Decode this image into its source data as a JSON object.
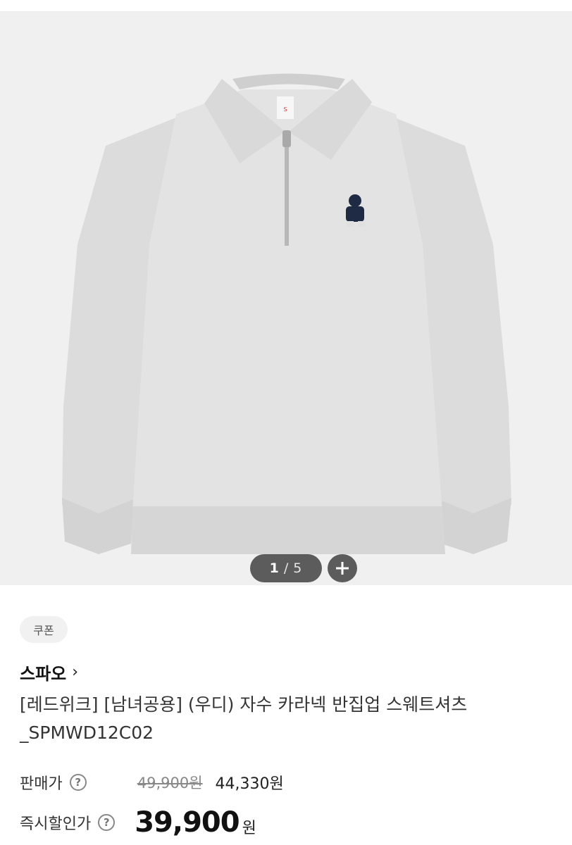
{
  "gallery": {
    "current": "1",
    "separator": "/",
    "total": "5",
    "image": {
      "main": "#e6e6e6",
      "accent": "#1f2a44"
    }
  },
  "icons": {
    "zoom": "plus-icon",
    "help": "question-circle-icon",
    "brand_link": "chevron-right-icon"
  },
  "product": {
    "coupon": "쿠폰",
    "brand": "스파오",
    "brand_chevron": "›",
    "title": "[레드위크] [남녀공용] (우디) 자수 카라넥 반집업 스웨트셔츠_SPMWD12C02",
    "sale_price_label": "판매가",
    "original_price": "49,900원",
    "sale_price": "44,330원",
    "instant_discount_label": "즉시할인가",
    "final_price": "39,900",
    "final_price_unit": "원",
    "help_glyph": "?"
  }
}
